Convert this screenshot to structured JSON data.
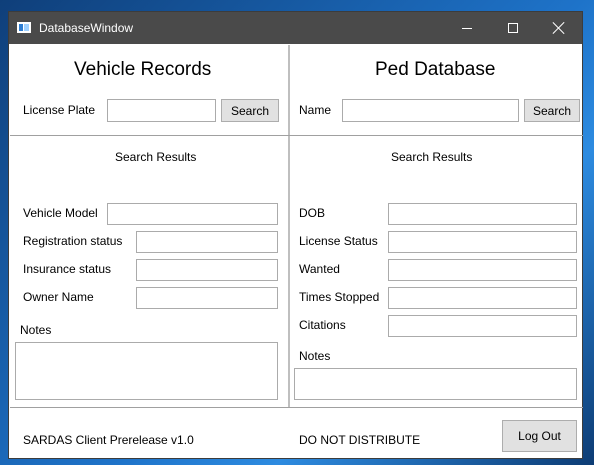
{
  "window": {
    "title": "DatabaseWindow"
  },
  "vehicle": {
    "heading": "Vehicle Records",
    "plate_label": "License Plate",
    "plate_value": "",
    "search_label": "Search",
    "results_label": "Search Results",
    "fields": {
      "model_label": "Vehicle Model",
      "registration_label": "Registration status",
      "insurance_label": "Insurance status",
      "owner_label": "Owner Name"
    },
    "notes_label": "Notes"
  },
  "ped": {
    "heading": "Ped Database",
    "name_label": "Name",
    "name_value": "",
    "search_label": "Search",
    "results_label": "Search Results",
    "fields": {
      "dob_label": "DOB",
      "license_label": "License Status",
      "wanted_label": "Wanted",
      "stopped_label": "Times Stopped",
      "citations_label": "Citations"
    },
    "notes_label": "Notes"
  },
  "footer": {
    "version": "SARDAS Client Prerelease v1.0",
    "notice": "DO NOT DISTRIBUTE",
    "logout_label": "Log Out"
  }
}
